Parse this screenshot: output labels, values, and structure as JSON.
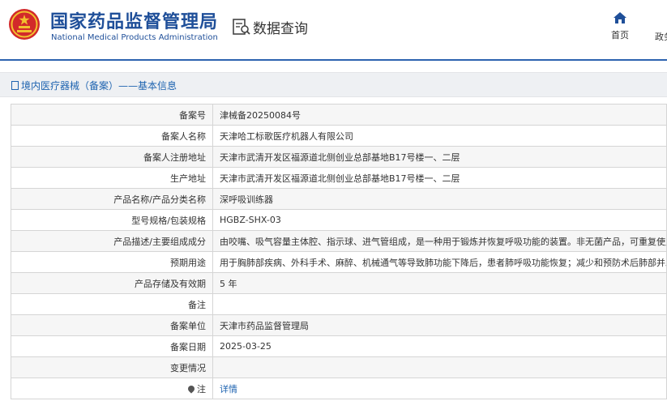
{
  "header": {
    "org_name_cn": "国家药品监督管理局",
    "org_name_en": "National Medical Products Administration",
    "query_title": "数据查询",
    "nav_home": "首页",
    "nav_more": "政务"
  },
  "breadcrumb": "境内医疗器械（备案）——基本信息",
  "rows": [
    {
      "label": "备案号",
      "value": "津械备20250084号"
    },
    {
      "label": "备案人名称",
      "value": "天津哈工标歌医疗机器人有限公司"
    },
    {
      "label": "备案人注册地址",
      "value": "天津市武清开发区福源道北侧创业总部基地B17号楼一、二层"
    },
    {
      "label": "生产地址",
      "value": "天津市武清开发区福源道北侧创业总部基地B17号楼一、二层"
    },
    {
      "label": "产品名称/产品分类名称",
      "value": "深呼吸训练器"
    },
    {
      "label": "型号规格/包装规格",
      "value": "HGBZ-SHX-03"
    },
    {
      "label": "产品描述/主要组成成分",
      "value": "由咬嘴、吸气容量主体腔、指示球、进气管组成，是一种用于锻炼并恢复呼吸功能的装置。非无菌产品，可重复使用。"
    },
    {
      "label": "预期用途",
      "value": "用于胸肺部疾病、外科手术、麻醉、机械通气等导致肺功能下降后，患者肺呼吸功能恢复；减少和预防术后肺部并发症。"
    },
    {
      "label": "产品存储及有效期",
      "value": "5 年"
    },
    {
      "label": "备注",
      "value": ""
    },
    {
      "label": "备案单位",
      "value": "天津市药品监督管理局"
    },
    {
      "label": "备案日期",
      "value": "2025-03-25"
    },
    {
      "label": "变更情况",
      "value": ""
    },
    {
      "label": "注",
      "value": "详情"
    }
  ],
  "icons": {
    "emblem": "national-emblem-icon",
    "query": "data-query-icon",
    "home": "home-icon",
    "note": "location-pin-icon"
  },
  "colors": {
    "brand_blue": "#1f4f99",
    "link_blue": "#1e63b0",
    "emblem_red": "#d22a2a",
    "emblem_gold": "#f2c12e"
  }
}
